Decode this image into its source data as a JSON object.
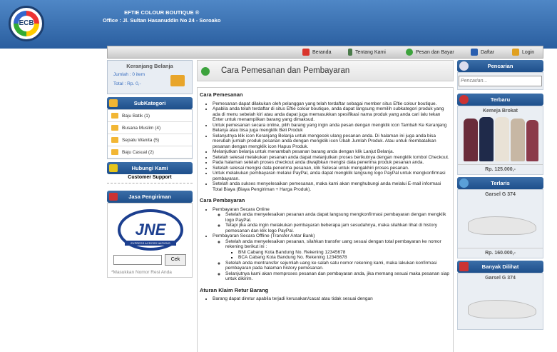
{
  "header": {
    "brand_line1": "EFTIE COLOUR BOUTIQUE ®",
    "brand_line2": "Office : Jl. Sultan Hasanuddin No 24 - Soroako",
    "logo_text": "ECB"
  },
  "nav": {
    "items": [
      {
        "label": "Beranda",
        "icon": "home-icon",
        "color": "#d9342b"
      },
      {
        "label": "Tentang Kami",
        "icon": "info-icon",
        "color": "#4a7a4a"
      },
      {
        "label": "Pesan dan Bayar",
        "icon": "order-icon",
        "color": "#3da33d"
      },
      {
        "label": "Daftar",
        "icon": "register-icon",
        "color": "#2a5fb0"
      },
      {
        "label": "Login",
        "icon": "lock-icon",
        "color": "#e0a020"
      }
    ]
  },
  "cart": {
    "title": "Keranjang Belanja",
    "jumlah": "Jumlah : 0 item",
    "total": "Total : Rp. 0,-"
  },
  "subkategori": {
    "title": "SubKategori",
    "items": [
      "Baju Batik (1)",
      "Busana Muslim (4)",
      "Sepatu Wanita (5)",
      "Baju Casual (2)"
    ]
  },
  "hubungi": {
    "title": "Hubungi Kami",
    "support": "Customer Support"
  },
  "jasa": {
    "title": "Jasa Pengiriman",
    "logo": "JNE",
    "logo_sub": "EXPRESS ACROSS NATIONS",
    "button": "Cek",
    "note": "*Masukkan Nomor Resi Anda"
  },
  "page": {
    "title": "Cara Pemesanan dan Pembayaran"
  },
  "content": {
    "h1": "Cara Pemesanan",
    "pemesanan": [
      "Pemesanan dapat dilakukan oleh pelanggan yang telah terdaftar sebagai member situs Eftie colour boutique.",
      "Apabila anda telah terdaftar di situs Eftie colour boutique, anda dapat langsung memilih subkategori produk yang ada di menu sebelah kiri atau anda dapat juga memasukkan spesifikasi nama produk yang anda cari lalu tekan Enter untuk menampilkan barang yang dimaksud.",
      "Untuk pemesanan secara online, pilih barang yang ingin anda pesan dengan mengklik icon Tambah Ke Keranjang Belanja atau bisa juga mengklik Beli Produk",
      "Selanjutnya klik icon Keranjang Belanja untuk mengecek ulang pesanan anda. Di halaman ini juga anda bisa merubah jumlah produk pesanan anda dengan mengklik icon Ubah Jumlah Produk. Atau untuk membatalkan pesanan dengan mengklik icon Hapus Produk.",
      "Melanjutkan belanja untuk menambah pesanan barang anda dengan klik Lanjut Belanja.",
      "Setelah selesai melakukan pesanan anda dapat melanjutkan proses berikutnya dengan mengklik tombol Checkout.",
      "Pada halaman setelah proses checkout anda diwajibkan mengisi data penerima produk pesanan anda.",
      "Setelah selesai mengisi data penerima pesanan, klik Selesai untuk mengakhiri proses pesanan.",
      "Untuk melakukan pembayaran melalui PayPal, anda dapat mengklik langsung logo PayPal untuk mengkonfirmasi pembayaran.",
      "Setelah anda sukses menyelesaikan pemesanan, maka kami akan menghubungi anda melalui E-mail informasi Total Biaya (Biaya Pengiriman + Harga Produk)."
    ],
    "h2": "Cara Pembayaran",
    "online_title": "Pembayaran Secara Online",
    "online": [
      "Setelah anda menyelesaikan pesanan anda dapat langsung mengkonfirmasi pembayaran dengan mengklik logo PayPal.",
      "Tetapi jika anda ingin melakukan pembayaran beberapa jam sesudahnya, maka silahkan lihat di history pemesanan dan klik logo PayPal."
    ],
    "offline_title": "Pembayaran Secara Offline (Transfer Antar Bank)",
    "offline_a": "Setelah anda menyelesaikan pesanan, silahkan transfer uang sesuai dengan total pembayaran ke nomor rekening berikut ini :",
    "banks": [
      "BNI Cabang Kota Bandung No. Rekening 12345678",
      "BCA Cabang Kota Bandung No. Rekening 12345678"
    ],
    "offline_b": "Setelah anda mentransfer sejumlah uang ke salah satu nomor rekening kami, maka lakukan konfirmasi pembayaran pada halaman history pemesanan.",
    "offline_c": "Selanjutnya kami akan memproses pesanan dan pembayaran anda, jika memang sesuai maka pesanan siap untuk dikirim.",
    "h3": "Aturan Klaim Retur Barang",
    "retur": "Barang dapat diretur apabila terjadi kerusakan/cacat atau tidak sesuai dengan"
  },
  "pencarian": {
    "title": "Pencarian",
    "placeholder": "Pencarian..."
  },
  "terbaru": {
    "title": "Terbaru",
    "name": "Kemeja Brokat",
    "price": "Rp. 125.000,-"
  },
  "terlaris": {
    "title": "Terlaris",
    "name": "Garsel G 374",
    "price": "Rp. 160.000,-"
  },
  "banyak": {
    "title": "Banyak Dilihat",
    "name": "Garsel G 374"
  }
}
